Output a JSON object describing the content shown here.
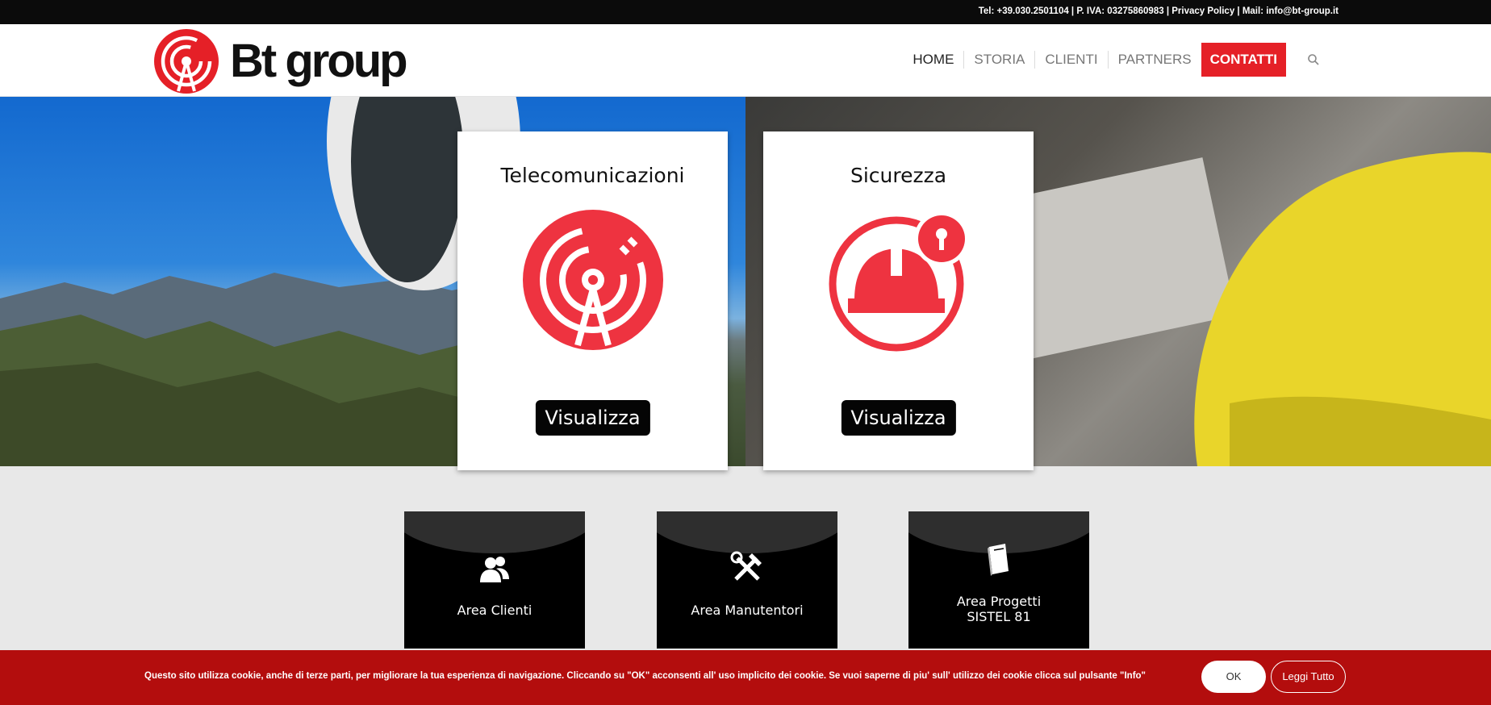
{
  "topbar": {
    "info": "Tel: +39.030.2501104 | P. IVA: 03275860983 | Privacy Policy | Mail: info@bt-group.it"
  },
  "brand": {
    "logo_text": "Bt group",
    "accent_color": "#e52027"
  },
  "nav": {
    "items": [
      "HOME",
      "STORIA",
      "CLIENTI",
      "PARTNERS"
    ],
    "cta": "CONTATTI",
    "search_icon": "search-icon"
  },
  "cards": [
    {
      "title": "Telecomunicazioni",
      "icon": "antenna-icon",
      "button": "Visualizza"
    },
    {
      "title": "Sicurezza",
      "icon": "helmet-lock-icon",
      "button": "Visualizza"
    }
  ],
  "areas": [
    {
      "label": "Area Clienti",
      "icon": "users-icon"
    },
    {
      "label": "Area Manutentori",
      "icon": "tools-icon"
    },
    {
      "label_line1": "Area Progetti",
      "label_line2": "SISTEL 81",
      "icon": "book-icon"
    }
  ],
  "cookie": {
    "message": "Questo sito utilizza cookie, anche di terze parti, per migliorare la tua esperienza di navigazione. Cliccando su \"OK\" acconsenti all' uso implicito dei cookie. Se vuoi saperne di piu' sull' utilizzo dei cookie clicca sul pulsante \"Info\"",
    "ok_label": "OK",
    "more_label": "Leggi Tutto",
    "bar_color": "#b30d0d"
  }
}
